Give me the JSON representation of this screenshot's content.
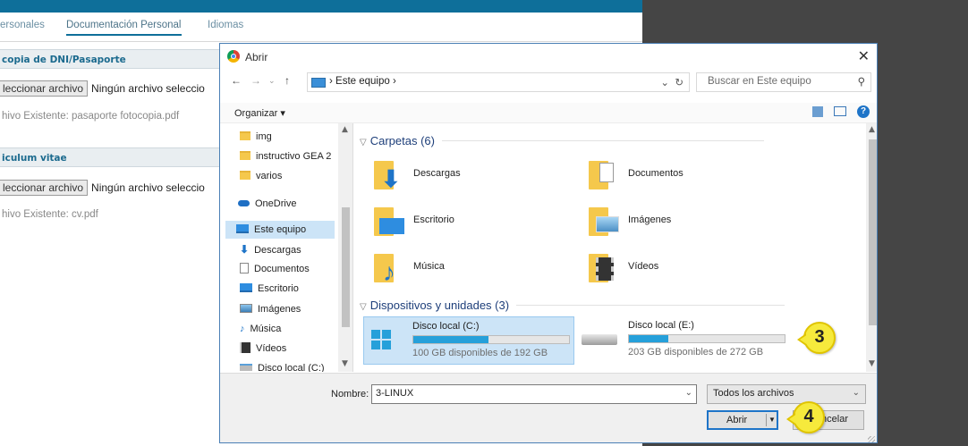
{
  "background": {
    "tabs": [
      "ersonales",
      "Documentación Personal",
      "Idiomas"
    ],
    "sections": [
      {
        "title": "copia de DNI/Pasaporte",
        "file_button": "leccionar archivo",
        "no_file": "Ningún archivo seleccio",
        "existing": "hivo Existente: pasaporte fotocopia.pdf"
      },
      {
        "title": "iculum vitae",
        "file_button": "leccionar archivo",
        "no_file": "Ningún archivo seleccio",
        "existing": "hivo Existente: cv.pdf"
      }
    ]
  },
  "dialog": {
    "title": "Abrir",
    "close": "✕",
    "address": {
      "path": "Este equipo",
      "separator": "›",
      "refresh": "↻"
    },
    "search_placeholder": "Buscar en Este equipo",
    "toolbar": {
      "organize": "Organizar ▾",
      "help": "?"
    },
    "nav": [
      {
        "label": "img",
        "icon": "folder-icon"
      },
      {
        "label": "instructivo GEA 2",
        "icon": "folder-icon"
      },
      {
        "label": "varios",
        "icon": "folder-icon"
      },
      {
        "label": "OneDrive",
        "icon": "onedrive-icon"
      },
      {
        "label": "Este equipo",
        "icon": "computer-icon",
        "selected": true
      },
      {
        "label": "Descargas",
        "icon": "downloads-icon"
      },
      {
        "label": "Documentos",
        "icon": "documents-icon"
      },
      {
        "label": "Escritorio",
        "icon": "desktop-icon"
      },
      {
        "label": "Imágenes",
        "icon": "pictures-icon"
      },
      {
        "label": "Música",
        "icon": "music-icon"
      },
      {
        "label": "Vídeos",
        "icon": "videos-icon"
      },
      {
        "label": "Disco local (C:)",
        "icon": "drive-icon"
      }
    ],
    "folders_header": "Carpetas (6)",
    "folders": [
      {
        "label": "Descargas",
        "icon": "downloads-folder-icon"
      },
      {
        "label": "Documentos",
        "icon": "documents-folder-icon"
      },
      {
        "label": "Escritorio",
        "icon": "desktop-folder-icon"
      },
      {
        "label": "Imágenes",
        "icon": "pictures-folder-icon"
      },
      {
        "label": "Música",
        "icon": "music-folder-icon"
      },
      {
        "label": "Vídeos",
        "icon": "videos-folder-icon"
      }
    ],
    "devices_header": "Dispositivos y unidades (3)",
    "drives": [
      {
        "name": "Disco local (C:)",
        "free": "100 GB disponibles de 192 GB",
        "used_fraction": 0.48,
        "selected": true
      },
      {
        "name": "Disco local (E:)",
        "free": "203 GB disponibles de 272 GB",
        "used_fraction": 0.25,
        "selected": false
      }
    ],
    "name_label": "Nombre:",
    "name_value": "3-LINUX",
    "file_type": "Todos los archivos",
    "open_button": "Abrir",
    "cancel_button": "Cancelar"
  },
  "callouts": {
    "drive": "3",
    "open": "4"
  },
  "colors": {
    "accent": "#1e74c8",
    "callout": "#f6ea3c",
    "topbar": "#0e6f9a"
  }
}
